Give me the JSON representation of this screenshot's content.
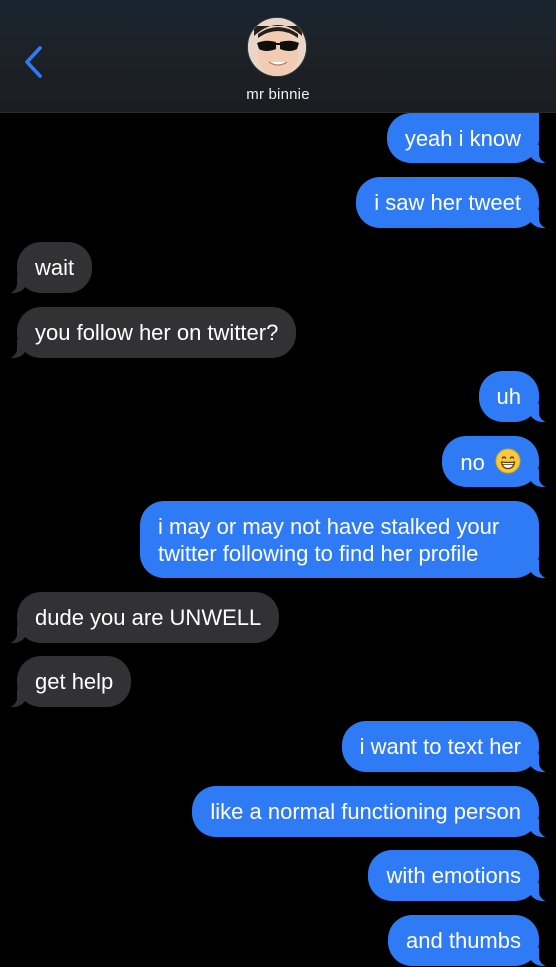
{
  "header": {
    "contact_name": "mr binnie",
    "back_icon": "chevron-left-icon",
    "accent_color": "#2f7bf6"
  },
  "messages": [
    {
      "direction": "sent",
      "text": "yeah i know"
    },
    {
      "direction": "sent",
      "text": "i saw her tweet"
    },
    {
      "direction": "received",
      "text": "wait"
    },
    {
      "direction": "received",
      "text": "you follow her on twitter?"
    },
    {
      "direction": "sent",
      "text": "uh"
    },
    {
      "direction": "sent",
      "text": "no",
      "emoji": "grinning-face"
    },
    {
      "direction": "sent",
      "text": "i may or may not have stalked your twitter following to find her profile"
    },
    {
      "direction": "received",
      "text": "dude you are UNWELL"
    },
    {
      "direction": "received",
      "text": "get help"
    },
    {
      "direction": "sent",
      "text": "i want to text her"
    },
    {
      "direction": "sent",
      "text": "like a normal functioning person"
    },
    {
      "direction": "sent",
      "text": "with emotions"
    },
    {
      "direction": "sent",
      "text": "and thumbs"
    }
  ],
  "colors": {
    "sent_bubble": "#2f7bf6",
    "received_bubble": "#323234",
    "background": "#000000"
  }
}
